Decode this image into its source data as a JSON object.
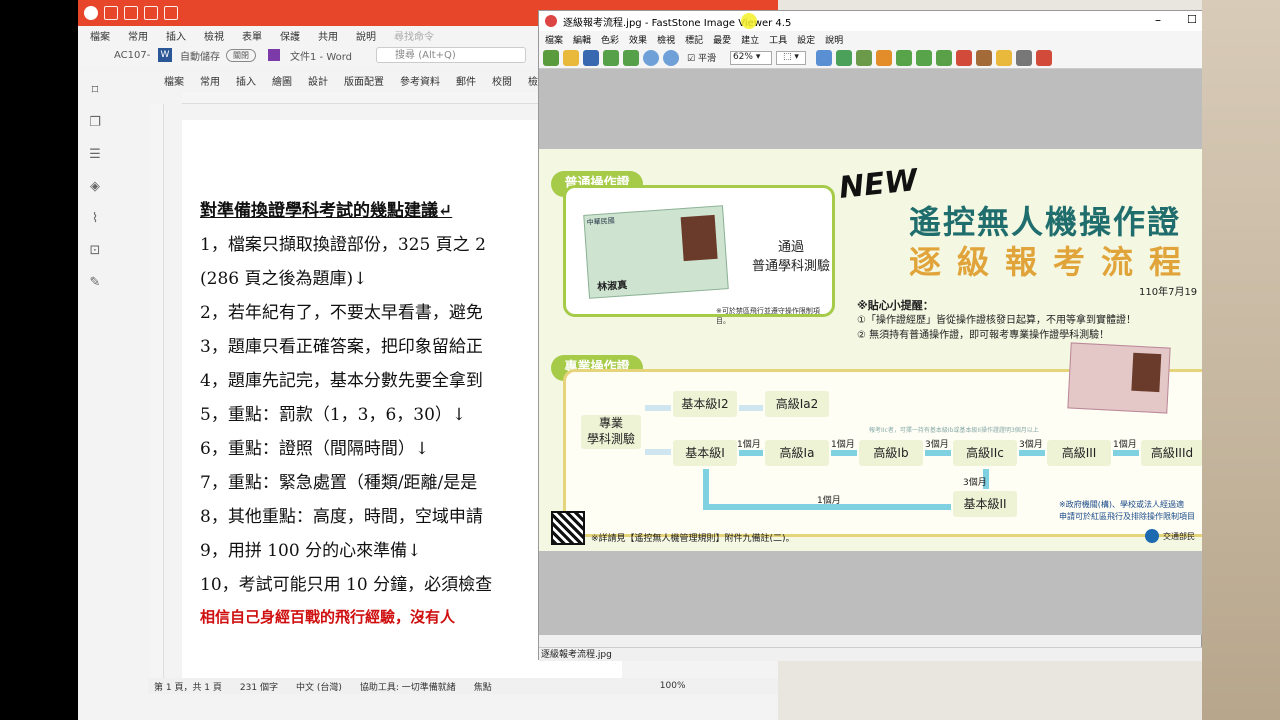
{
  "wps": {
    "menu": [
      "檔案",
      "常用",
      "插入",
      "檢視",
      "表單",
      "保護",
      "共用",
      "說明"
    ],
    "search_label": "尋找命令",
    "doc_tab": "AC107-0",
    "autosave": "自動儲存",
    "autosave_state": "關閉",
    "doc_name": "文件1 - Word",
    "search_placeholder": "搜尋 (Alt+Q)",
    "ribbon": [
      "檔案",
      "常用",
      "插入",
      "繪圖",
      "設計",
      "版面配置",
      "參考資料",
      "郵件",
      "校閱",
      "檢視",
      "增益"
    ],
    "lines": [
      "對準備換證學科考試的幾點建議↵",
      "1，檔案只擷取換證部份，325 頁之 2",
      "(286 頁之後為題庫)↓",
      "2，若年紀有了，不要太早看書，避免",
      "3，題庫只看正確答案，把印象留給正",
      "4，題庫先記完，基本分數先要全拿到",
      "5，重點：罰款（1，3，6，30）↓",
      "6，重點：證照（間隔時間）↓",
      "7，重點：緊急處置（種類/距離/是是",
      "8，其他重點：高度，時間，空域申請",
      "9，用拼 100 分的心來準備↓",
      "10，考試可能只用 10 分鐘，必須檢查",
      "相信自己身經百戰的飛行經驗，沒有人"
    ],
    "status": [
      "第 1 頁，共 1 頁",
      "231 個字",
      "中文 (台灣)",
      "協助工具: 一切準備就緒",
      "焦點",
      "100%"
    ]
  },
  "faststone": {
    "title": "逐級報考流程.jpg - FastStone Image Viewer 4.5",
    "menu": [
      "檔案",
      "編輯",
      "色彩",
      "效果",
      "檢視",
      "標記",
      "最愛",
      "建立",
      "工具",
      "設定",
      "說明"
    ],
    "smooth_label": "平滑",
    "zoom": "62%",
    "status_file": "逐級報考流程.jpg",
    "status_right": "1:"
  },
  "poster": {
    "new_label": "NEW",
    "title1": "遙控無人機操作證",
    "title2": "逐級報考流程",
    "date": "110年7月19",
    "tips_title": "※貼心小提醒：",
    "tip1": "①「操作證經歷」皆從操作證核發日起算，不用等拿到實體證！",
    "tip2": "② 無須持有普通操作證，即可報考專業操作證學科測驗！",
    "general_pill": "普通操作證",
    "general_pass": "通過\n普通學科測驗",
    "general_note": "※可於禁區飛行並遵守操作限制項目。",
    "pro_pill": "專業操作證",
    "pro_test": "專業\n學科測驗",
    "levels": [
      "基本級I2",
      "高級Ia2",
      "基本級I",
      "高級Ia",
      "高級Ib",
      "高級IIc",
      "高級III",
      "高級IIId",
      "基本級II"
    ],
    "months": [
      "1個月",
      "1個月",
      "3個月",
      "3個月",
      "1個月",
      "3個月",
      "1個月"
    ],
    "small_note": "報考IIc者，可擇一持有基本級Ib或基本級II操作證證明3個月以上",
    "gov_note1": "※政府機關(構)、學校或法人經過適",
    "gov_note2": "申請可於紅區飛行及排除操作限制項目",
    "footer": "※詳請見【遙控無人機管理規則】附件九備註(二)。",
    "org": "交通部民",
    "card_text": "中華民國",
    "seal": "林淑真"
  }
}
